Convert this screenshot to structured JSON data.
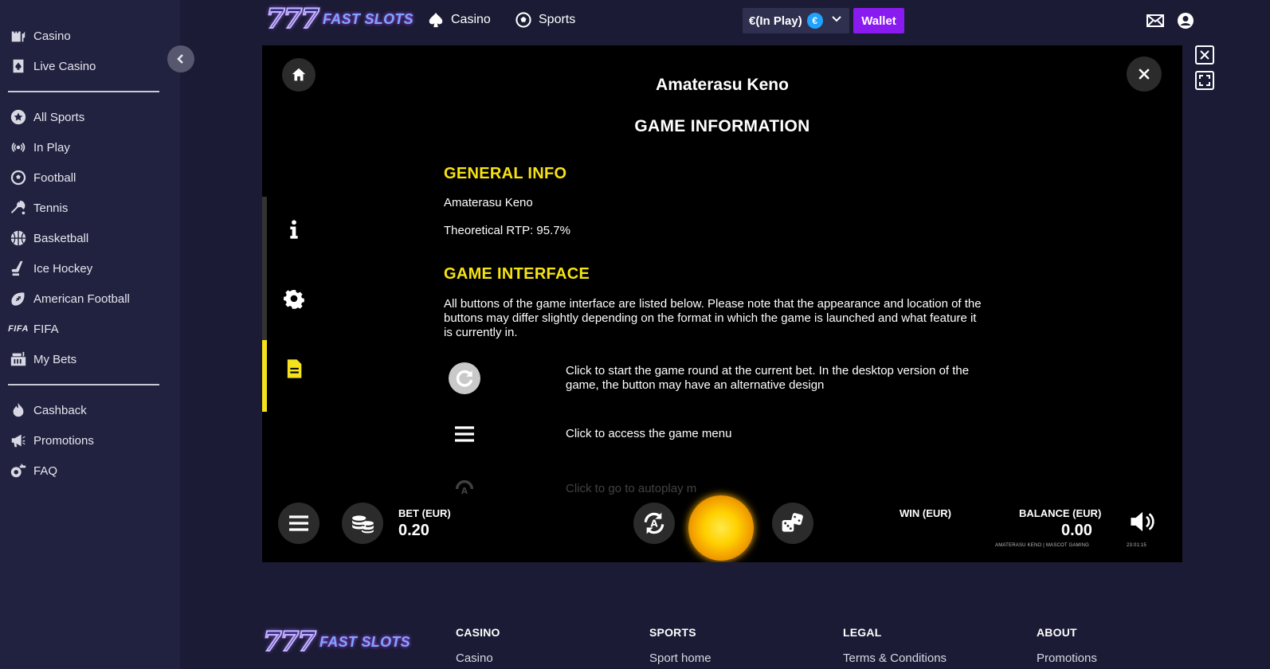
{
  "sidebar": {
    "group1": [
      {
        "label": "Casino",
        "icon": "casino-icon"
      },
      {
        "label": "Live Casino",
        "icon": "live-casino-icon"
      }
    ],
    "group2": [
      {
        "label": "All Sports",
        "icon": "all-sports-icon"
      },
      {
        "label": "In Play",
        "icon": "in-play-icon"
      },
      {
        "label": "Football",
        "icon": "football-icon"
      },
      {
        "label": "Tennis",
        "icon": "tennis-icon"
      },
      {
        "label": "Basketball",
        "icon": "basketball-icon"
      },
      {
        "label": "Ice Hockey",
        "icon": "ice-hockey-icon"
      },
      {
        "label": "American Football",
        "icon": "american-football-icon"
      },
      {
        "label": "FIFA",
        "icon": "fifa-icon",
        "icon_text": "FIFA"
      },
      {
        "label": "My Bets",
        "icon": "my-bets-icon"
      }
    ],
    "group3": [
      {
        "label": "Cashback",
        "icon": "cashback-icon"
      },
      {
        "label": "Promotions",
        "icon": "promotions-icon"
      },
      {
        "label": "FAQ",
        "icon": "faq-icon"
      }
    ]
  },
  "header": {
    "logo_digits": "777",
    "logo_text": "FAST SLOTS",
    "nav": [
      {
        "label": "Casino",
        "icon": "spade-icon"
      },
      {
        "label": "Sports",
        "icon": "soccer-ball-icon"
      }
    ],
    "balance_label": "€(In Play)",
    "currency_symbol": "€",
    "wallet_label": "Wallet"
  },
  "game": {
    "title": "Amaterasu Keno",
    "info_heading": "GAME INFORMATION",
    "general_info_title": "GENERAL INFO",
    "game_name": "Amaterasu Keno",
    "rtp": "Theoretical RTP: 95.7%",
    "interface_title": "GAME INTERFACE",
    "interface_desc": "All buttons of the game interface are listed below. Please note that the appearance and location of the buttons may differ slightly depending on the format in which the game is launched and what feature it is currently in.",
    "buttons": [
      {
        "icon": "refresh-icon",
        "text": "Click to start the game round at the current bet. In the desktop version of the game, the button may have an alternative design"
      },
      {
        "icon": "menu-icon",
        "text": "Click to access the game menu"
      },
      {
        "icon": "autoplay-icon",
        "text": "Click to go to autoplay m"
      }
    ],
    "bar": {
      "bet_label": "BET (EUR)",
      "bet_value": "0.20",
      "win_label": "WIN (EUR)",
      "balance_label": "BALANCE (EUR)",
      "balance_value": "0.00",
      "provider_text": "AMATERASU KENO | MASCOT GAMING",
      "clock": "23:01:15"
    }
  },
  "footer": {
    "logo_digits": "777",
    "logo_text": "FAST SLOTS",
    "columns": [
      {
        "heading": "CASINO",
        "link": "Casino"
      },
      {
        "heading": "SPORTS",
        "link": "Sport home"
      },
      {
        "heading": "LEGAL",
        "link": "Terms & Conditions"
      },
      {
        "heading": "ABOUT",
        "link": "Promotions"
      }
    ]
  }
}
